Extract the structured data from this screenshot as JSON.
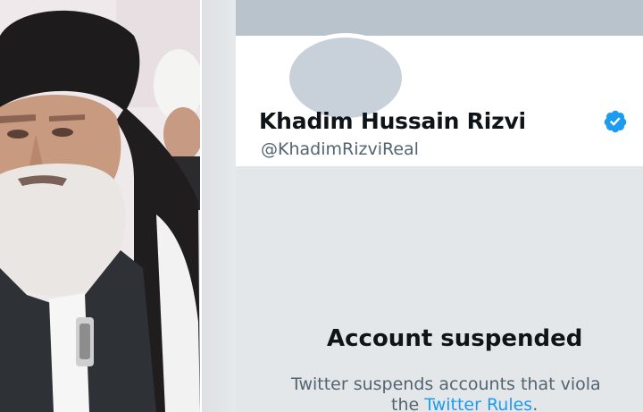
{
  "photo": {
    "description_icon": "person-photo"
  },
  "profile": {
    "display_name": "Khadim Hussain Rizvi",
    "handle": "@KhadimRizviReal",
    "verified_icon": "verified-badge-icon",
    "verified_color": "#1d9bf0"
  },
  "suspension": {
    "title": "Account suspended",
    "text": "Twitter suspends accounts that viola",
    "rules_prefix": "the ",
    "rules_link": "Twitter Rules",
    "rules_suffix": "."
  },
  "colors": {
    "banner": "#b8c3cc",
    "avatar": "#c8d1d9",
    "background": "#e4e7ea",
    "link": "#1d9bf0"
  }
}
